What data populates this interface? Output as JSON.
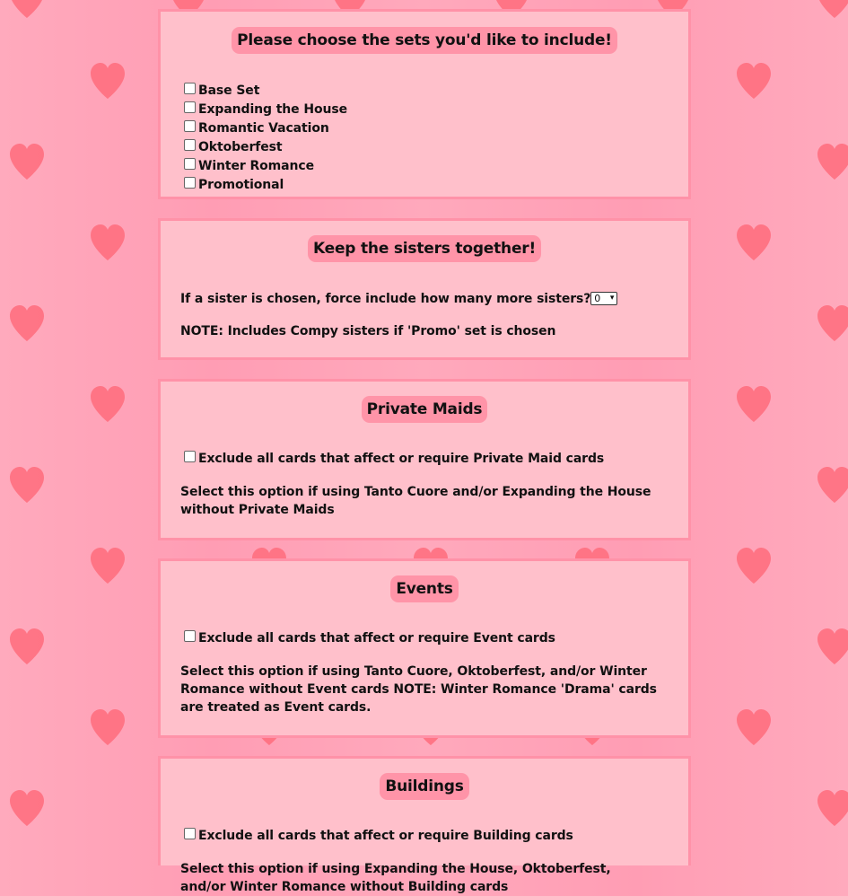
{
  "sets_panel": {
    "title": "Please choose the sets you'd like to include!",
    "options": [
      {
        "label": "Base Set",
        "checked": false
      },
      {
        "label": "Expanding the House",
        "checked": false
      },
      {
        "label": "Romantic Vacation",
        "checked": false
      },
      {
        "label": "Oktoberfest",
        "checked": false
      },
      {
        "label": "Winter Romance",
        "checked": false
      },
      {
        "label": "Promotional",
        "checked": false
      }
    ]
  },
  "sisters_panel": {
    "title": "Keep the sisters together!",
    "question": "If a sister is chosen, force include how many more sisters?",
    "select_value": "0",
    "note": "NOTE: Includes Compy sisters if 'Promo' set is chosen"
  },
  "private_maids_panel": {
    "title": "Private Maids",
    "checkbox_label": "Exclude all cards that affect or require Private Maid cards",
    "description": "Select this option if using Tanto Cuore and/or Expanding the House without Private Maids"
  },
  "events_panel": {
    "title": "Events",
    "checkbox_label": "Exclude all cards that affect or require Event cards",
    "description": "Select this option if using Tanto Cuore, Oktoberfest, and/or Winter Romance without Event cards NOTE: Winter Romance 'Drama' cards are treated as Event cards."
  },
  "buildings_panel": {
    "title": "Buildings",
    "checkbox_label": "Exclude all cards that affect or require Building cards",
    "description": "Select this option if using Expanding the House, Oktoberfest, and/or Winter Romance without Building cards"
  },
  "colors": {
    "background": "#ff9fb6",
    "panel": "#ffc0cb",
    "panel_border": "#ff92a8",
    "title_pill": "#ff94a8",
    "heart": "#ff6f7f"
  },
  "icons": {
    "background_decoration": "heart-icon",
    "select_arrow": "chevron-down-icon"
  }
}
